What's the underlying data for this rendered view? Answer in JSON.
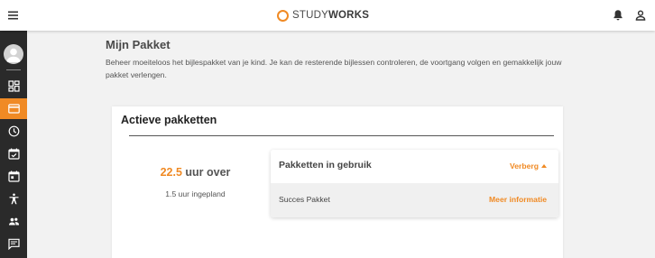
{
  "header": {
    "logo_prefix": "STUDY",
    "logo_suffix": "WORKS",
    "icons": [
      "menu-icon",
      "bell-icon",
      "user-icon"
    ]
  },
  "sidebar": {
    "items": [
      {
        "icon": "dashboard-icon",
        "active": false
      },
      {
        "icon": "package-card-icon",
        "active": true
      },
      {
        "icon": "clock-icon",
        "active": false
      },
      {
        "icon": "calendar-check-icon",
        "active": false
      },
      {
        "icon": "calendar-icon",
        "active": false
      },
      {
        "icon": "accessibility-icon",
        "active": false
      },
      {
        "icon": "group-icon",
        "active": false
      },
      {
        "icon": "chat-icon",
        "active": false
      }
    ]
  },
  "page": {
    "title": "Mijn Pakket",
    "description": "Beheer moeiteloos het bijlespakket van je kind. Je kan de resterende bijlessen controleren, de voortgang volgen en gemakkelijk jouw pakket verlengen."
  },
  "card": {
    "title": "Actieve pakketten",
    "hours_left_value": "22.5",
    "hours_left_suffix": " uur over",
    "hours_planned": "1.5 uur ingepland",
    "panel": {
      "title": "Pakketten in gebruik",
      "toggle_label": "Verberg",
      "package_name": "Succes Pakket",
      "more_label": "Meer informatie"
    }
  },
  "colors": {
    "accent": "#f08a24",
    "sidebar": "#2a2a2a",
    "background": "#f2f2f2"
  }
}
